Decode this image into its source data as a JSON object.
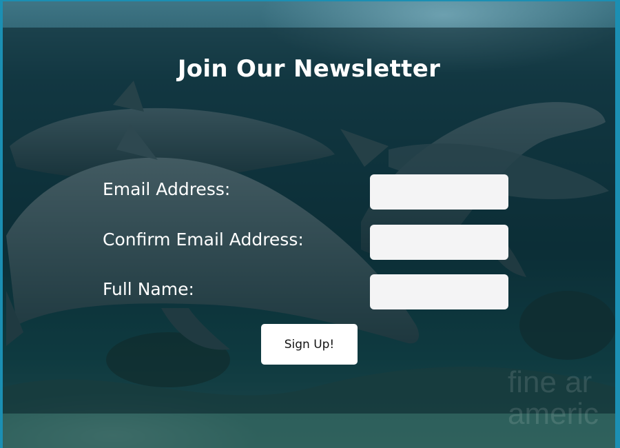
{
  "newsletter": {
    "title": "Join Our Newsletter",
    "email_label": "Email Address:",
    "confirm_email_label": "Confirm Email Address:",
    "full_name_label": "Full Name:",
    "email_value": "",
    "confirm_email_value": "",
    "full_name_value": "",
    "submit_label": "Sign Up!"
  },
  "background": {
    "image": "dolphins-underwater-photo",
    "watermark_line1": "fine ar",
    "watermark_line2": "americ"
  },
  "colors": {
    "page_border": "#1b8fb3",
    "overlay": "#082028",
    "field_background": "#f4f4f5",
    "text": "#ffffff"
  }
}
